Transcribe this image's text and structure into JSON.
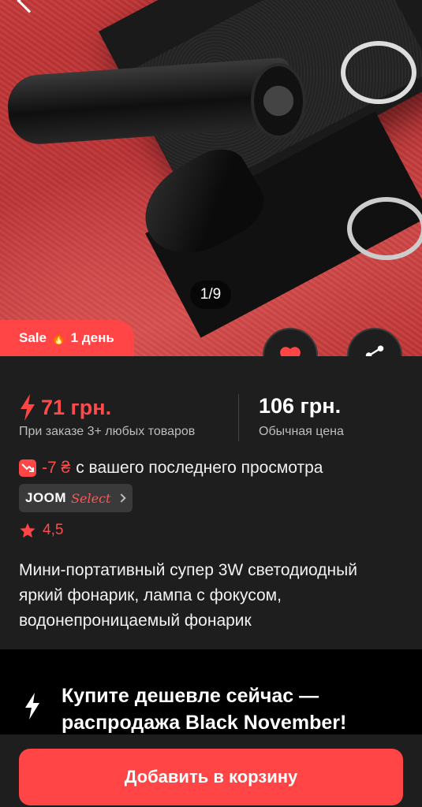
{
  "gallery": {
    "counter": "1/9",
    "sale_label": "Sale",
    "sale_icon": "fire-icon",
    "sale_duration": "1 день"
  },
  "actions": {
    "favorite_icon": "heart-icon",
    "share_icon": "share-icon"
  },
  "pricing": {
    "price": "71 грн.",
    "price_note": "При заказе 3+ любых товаров",
    "regular_price": "106 грн.",
    "regular_price_note": "Обычная цена"
  },
  "price_drop": {
    "value": "-7 ₴",
    "text": "с вашего последнего просмотра"
  },
  "joom_select": {
    "brand": "JOOM",
    "tier": "Select"
  },
  "rating": {
    "value": "4,5"
  },
  "product": {
    "title": "Мини-портативный супер 3W светодиодный яркий фонарик, лампа с фокусом, водонепроницаемый фонарик"
  },
  "promo": {
    "text": "Купите дешевле сейчас — распродажа Black November!"
  },
  "cart": {
    "add_label": "Добавить в корзину"
  },
  "colors": {
    "accent": "#ff4545",
    "background": "#1e1e1e",
    "promo_background": "#000000"
  }
}
